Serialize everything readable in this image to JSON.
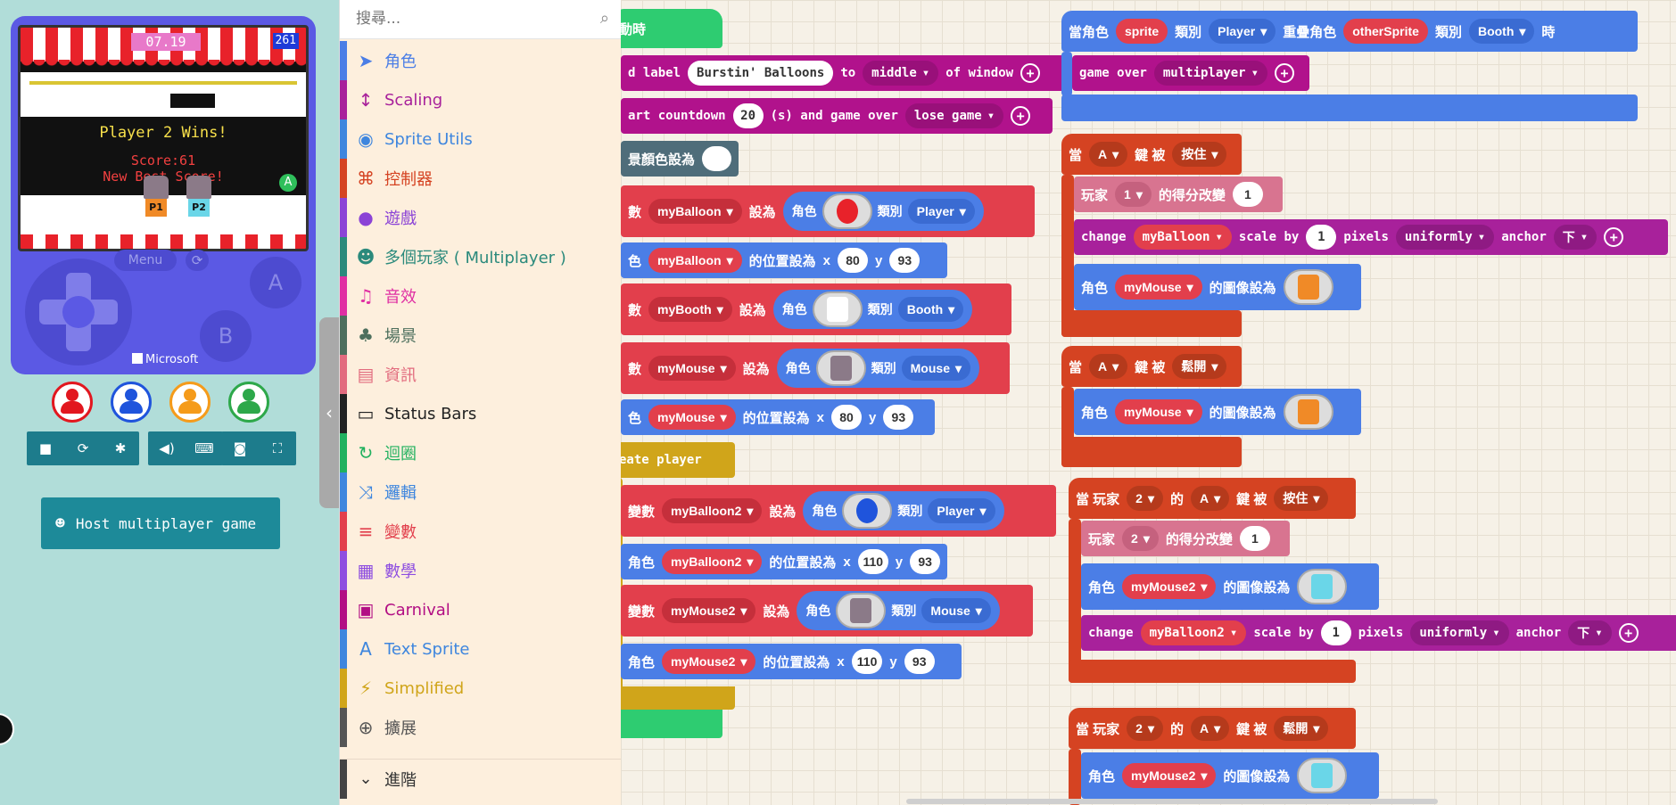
{
  "simulator": {
    "timer": "07.19",
    "score_box": "261",
    "win_text": "Player 2 Wins!",
    "score_text": "Score:61",
    "best_text": "New Best Score!",
    "a_badge": "A",
    "mouse_p1": "P1",
    "mouse_p2": "P2",
    "menu_label": "Menu",
    "btn_a": "A",
    "btn_b": "B",
    "brand": "Microsoft",
    "host_label": "Host multiplayer game",
    "player_colors": [
      "#e2171f",
      "#1f54dc",
      "#f59b1a",
      "#2da84a"
    ]
  },
  "toolbox": {
    "search_placeholder": "搜尋...",
    "categories": [
      {
        "label": "角色",
        "icon": "paper-plane-icon",
        "color": "#4b7ee6"
      },
      {
        "label": "Scaling",
        "icon": "resize-vertical-icon",
        "color": "#a8219b"
      },
      {
        "label": "Sprite Utils",
        "icon": "user-circle-icon",
        "color": "#3e86de"
      },
      {
        "label": "控制器",
        "icon": "gamepad-icon",
        "color": "#d54322"
      },
      {
        "label": "遊戲",
        "icon": "circle-icon",
        "color": "#8b43d6"
      },
      {
        "label": "多個玩家 ( Multiplayer )",
        "icon": "users-icon",
        "color": "#2b8a7c"
      },
      {
        "label": "音效",
        "icon": "headphones-icon",
        "color": "#e02fa3"
      },
      {
        "label": "場景",
        "icon": "tree-icon",
        "color": "#4d6f5d"
      },
      {
        "label": "資訊",
        "icon": "id-card-icon",
        "color": "#e26b7e"
      },
      {
        "label": "Status Bars",
        "icon": "battery-icon",
        "color": "#222222"
      },
      {
        "label": "迴圈",
        "icon": "refresh-icon",
        "color": "#21b15f"
      },
      {
        "label": "邏輯",
        "icon": "shuffle-icon",
        "color": "#3e86de"
      },
      {
        "label": "變數",
        "icon": "list-icon",
        "color": "#e23f4c"
      },
      {
        "label": "數學",
        "icon": "calculator-icon",
        "color": "#8e4ee0"
      },
      {
        "label": "Carnival",
        "icon": "ticket-icon",
        "color": "#b20f84"
      },
      {
        "label": "Text Sprite",
        "icon": "letter-a-icon",
        "color": "#3e86de"
      },
      {
        "label": "Simplified",
        "icon": "bolt-icon",
        "color": "#d0a51a"
      },
      {
        "label": "擴展",
        "icon": "plus-circle-icon",
        "color": "#555555"
      }
    ],
    "advanced": "進階"
  },
  "workspace": {
    "event_start": "動時",
    "add_label": {
      "pre": "d label",
      "text": "Burstin' Balloons",
      "to": "to",
      "pos": "middle",
      "post": "of window"
    },
    "countdown": {
      "pre": "art countdown",
      "sec": "20",
      "unit": "(s) and game over",
      "mode": "lose game"
    },
    "bg_color": "景顏色設為",
    "set1": {
      "pre": "數",
      "var": "myBalloon",
      "set": "設為",
      "sprite": "角色",
      "kind": "類別",
      "kindval": "Player"
    },
    "pos1": {
      "pre": "色",
      "var": "myBalloon",
      "mid": "的位置設為",
      "x": "x",
      "xv": "80",
      "y": "y",
      "yv": "93"
    },
    "set2": {
      "pre": "數",
      "var": "myBooth",
      "set": "設為",
      "sprite": "角色",
      "kind": "類別",
      "kindval": "Booth"
    },
    "set3": {
      "pre": "數",
      "var": "myMouse",
      "set": "設為",
      "sprite": "角色",
      "kind": "類別",
      "kindval": "Mouse"
    },
    "pos3": {
      "pre": "色",
      "var": "myMouse",
      "mid": "的位置設為",
      "x": "x",
      "xv": "80",
      "y": "y",
      "yv": "93"
    },
    "create_player": "eate player",
    "set4": {
      "pre": "變數",
      "var": "myBalloon2",
      "set": "設為",
      "sprite": "角色",
      "kind": "類別",
      "kindval": "Player"
    },
    "pos4": {
      "pre": "角色",
      "var": "myBalloon2",
      "mid": "的位置設為",
      "x": "x",
      "xv": "110",
      "y": "y",
      "yv": "93"
    },
    "set5": {
      "pre": "變數",
      "var": "myMouse2",
      "set": "設為",
      "sprite": "角色",
      "kind": "類別",
      "kindval": "Mouse"
    },
    "pos5": {
      "pre": "角色",
      "var": "myMouse2",
      "mid": "的位置設為",
      "x": "x",
      "xv": "110",
      "y": "y",
      "yv": "93"
    },
    "overlap": {
      "a": "當角色",
      "s1": "sprite",
      "k": "類別",
      "k1": "Player",
      "mid": "重疊角色",
      "s2": "otherSprite",
      "k2": "Booth",
      "end": "時"
    },
    "game_over": {
      "label": "game over",
      "mode": "multiplayer"
    },
    "press1": {
      "when": "當",
      "key": "A",
      "by": "鍵 被",
      "act": "按住"
    },
    "score1": {
      "pl": "玩家",
      "n": "1",
      "txt": "的得分改變",
      "v": "1"
    },
    "scale1": {
      "c": "change",
      "var": "myBalloon",
      "sb": "scale by",
      "v": "1",
      "px": "pixels",
      "mode": "uniformly",
      "anc": "anchor",
      "dir": "下"
    },
    "img1": {
      "s": "角色",
      "var": "myMouse",
      "txt": "的圖像設為"
    },
    "release1": {
      "when": "當",
      "key": "A",
      "by": "鍵 被",
      "act": "鬆開"
    },
    "img2": {
      "s": "角色",
      "var": "myMouse",
      "txt": "的圖像設為"
    },
    "press2": {
      "when": "當 玩家",
      "n": "2",
      "of": "的",
      "key": "A",
      "by": "鍵 被",
      "act": "按住"
    },
    "score2": {
      "pl": "玩家",
      "n": "2",
      "txt": "的得分改變",
      "v": "1"
    },
    "img3": {
      "s": "角色",
      "var": "myMouse2",
      "txt": "的圖像設為"
    },
    "scale2": {
      "c": "change",
      "var": "myBalloon2",
      "sb": "scale by",
      "v": "1",
      "px": "pixels",
      "mode": "uniformly",
      "anc": "anchor",
      "dir": "下"
    },
    "release2": {
      "when": "當 玩家",
      "n": "2",
      "of": "的",
      "key": "A",
      "by": "鍵 被",
      "act": "鬆開"
    },
    "img4": {
      "s": "角色",
      "var": "myMouse2",
      "txt": "的圖像設為"
    }
  }
}
